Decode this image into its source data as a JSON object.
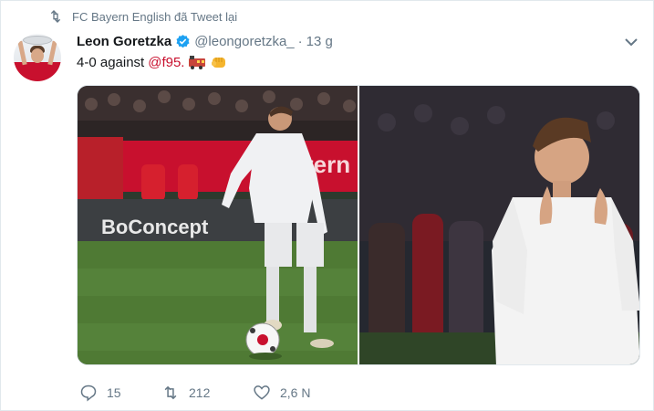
{
  "retweet_context": {
    "label": "FC Bayern English đã Tweet lại",
    "icon": "retweet-icon"
  },
  "tweet": {
    "author_name": "Leon Goretzka",
    "verified": true,
    "handle": "@leongoretzka_",
    "separator": "·",
    "time": "13 g",
    "text_prefix": "4-0 against",
    "mention": "@f95.",
    "emojis": [
      "train-emoji",
      "fist-emoji"
    ],
    "media": [
      {
        "kind": "photo",
        "subject": "player dribbling ball on pitch",
        "stadium_ad": "BoConcept",
        "banner_text": "tern"
      },
      {
        "kind": "photo",
        "subject": "player applauding"
      }
    ]
  },
  "actions": {
    "reply": {
      "icon": "reply-icon",
      "count": "15"
    },
    "retweet": {
      "icon": "retweet-icon",
      "count": "212"
    },
    "like": {
      "icon": "heart-icon",
      "count": "2,6 N"
    }
  },
  "colors": {
    "accent": "#c8102e",
    "muted": "#657786",
    "verified": "#1da1f2",
    "text": "#14171a"
  }
}
